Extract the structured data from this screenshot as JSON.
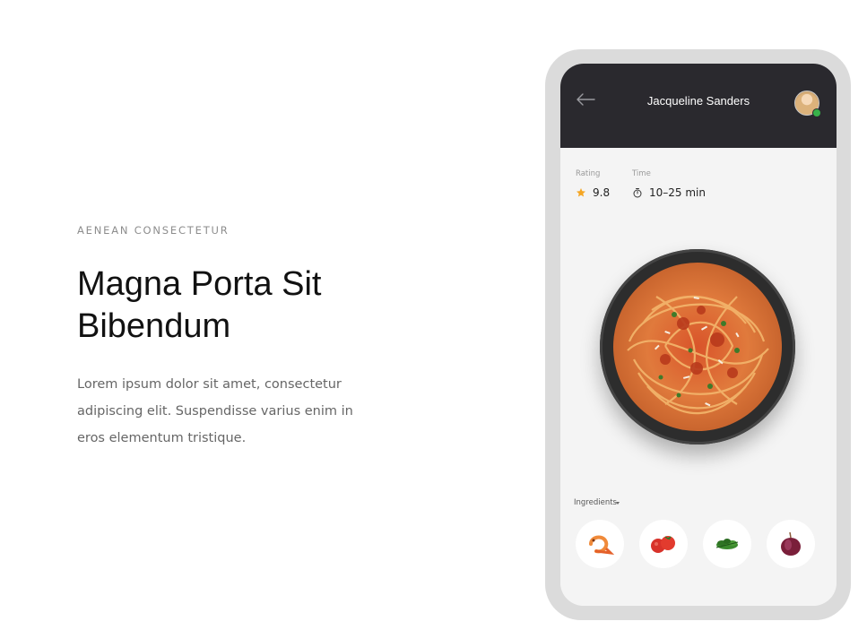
{
  "hero": {
    "eyebrow": "AENEAN CONSECTETUR",
    "title_line1": "Magna Porta Sit",
    "title_line2": "Bibendum",
    "description": "Lorem ipsum dolor sit amet, consectetur adipiscing elit. Suspendisse varius enim in eros elementum tristique."
  },
  "app": {
    "header": {
      "back_icon": "arrow-left-icon",
      "user_name": "Jacqueline Sanders",
      "avatar_status": "online"
    },
    "stats": {
      "rating_label": "Rating",
      "rating_value": "9.8",
      "rating_icon": "star-icon",
      "time_label": "Time",
      "time_value": "10–25 min",
      "time_icon": "stopwatch-icon"
    },
    "dish_image": "spaghetti-bolognese",
    "ingredients_label": "Ingredients",
    "ingredients": [
      {
        "icon": "shrimp-icon"
      },
      {
        "icon": "tomato-icon"
      },
      {
        "icon": "herb-icon"
      },
      {
        "icon": "onion-icon"
      }
    ]
  },
  "colors": {
    "header_bg": "#2a292e",
    "phone_frame": "#dbdbdb",
    "screen_bg": "#f4f4f4",
    "star": "#f5a623",
    "online": "#38b24a"
  }
}
